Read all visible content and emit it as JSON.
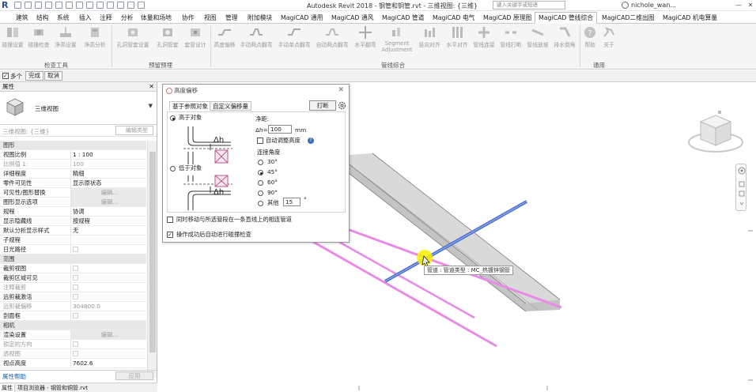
{
  "titlebar": {
    "app_title": "Autodesk Revit 2018 -   钢管和铜管.rvt - 三维视图: {三维}",
    "search_placeholder": "键入关键字或短语",
    "user": "nichole_wan...",
    "minimize": "—",
    "close": "✕"
  },
  "menu": {
    "tabs": [
      "建筑",
      "结构",
      "系统",
      "插入",
      "注释",
      "分析",
      "体量和场地",
      "协作",
      "视图",
      "管理",
      "附加模块",
      "MagiCAD 通用",
      "MagiCAD 通风",
      "MagiCAD 管道",
      "MagiCAD 电气",
      "MagiCAD 原理图",
      "MagiCAD 管线综合",
      "MagiCAD二维出图",
      "MagiCAD 机电算量"
    ],
    "active": "MagiCAD 管线综合"
  },
  "ribbon": {
    "buttons": [
      "碰撞设置",
      "碰撞检查",
      "净高设置",
      "净高分析",
      "孔洞管套设置",
      "孔洞管套",
      "套管设计",
      "高度偏移",
      "手动两点翻弯",
      "手动单点翻弯",
      "自动两点翻弯",
      "水平翻弯",
      "Segment Adjustment",
      "竖向对齐",
      "水平对齐",
      "管线连接",
      "管线打断",
      "管线放坡",
      "排水倒角",
      "帮助",
      "关于"
    ],
    "panels": [
      "检查工具",
      "预留预埋",
      "管线综合",
      "通用"
    ]
  },
  "optionbar": {
    "multi_label": "多个",
    "multi_checked": true,
    "finish_button": "完成",
    "cancel_button": "取消"
  },
  "properties": {
    "header": "属性",
    "close": "✕",
    "type_name": "三维视图",
    "view_selector": "三维视图: {三维}",
    "edit_type_button": "编辑类型",
    "rows": [
      {
        "type": "section",
        "k": "图形"
      },
      {
        "k": "视图比例",
        "v": "1 : 100"
      },
      {
        "k": "比例值 1:",
        "v": "100",
        "dim": true
      },
      {
        "k": "详细程度",
        "v": "精细"
      },
      {
        "k": "零件可见性",
        "v": "显示原状态"
      },
      {
        "k": "可见性/图形替换",
        "v": "编辑...",
        "btn": true
      },
      {
        "k": "图形显示选项",
        "v": "编辑...",
        "btn": true
      },
      {
        "k": "规程",
        "v": "协调"
      },
      {
        "k": "显示隐藏线",
        "v": "按规程"
      },
      {
        "k": "默认分析显示样式",
        "v": "无"
      },
      {
        "k": "子规程",
        "v": ""
      },
      {
        "k": "日光路径",
        "v": "",
        "check": true
      },
      {
        "type": "section",
        "k": "范围"
      },
      {
        "k": "裁剪视图",
        "v": "",
        "check": true
      },
      {
        "k": "裁剪区域可见",
        "v": "",
        "check": true
      },
      {
        "k": "注释裁剪",
        "v": "",
        "check": true,
        "dim": true
      },
      {
        "k": "远剪裁激活",
        "v": "",
        "check": true
      },
      {
        "k": "远剪裁偏移",
        "v": "304800.0",
        "dim": true
      },
      {
        "k": "剖面框",
        "v": "",
        "check": true
      },
      {
        "type": "section",
        "k": "相机"
      },
      {
        "k": "渲染设置",
        "v": "编辑...",
        "btn": true
      },
      {
        "k": "锁定的方向",
        "v": "",
        "check": true,
        "dim": true
      },
      {
        "k": "透视图",
        "v": "",
        "check": true,
        "dim": true
      },
      {
        "k": "视点高度",
        "v": "7602.6"
      }
    ],
    "help_link": "属性帮助",
    "apply_button": "应用",
    "bottom_tabs": [
      "属性",
      "项目浏览器 - 钢管和铜管.rvt"
    ]
  },
  "dialog": {
    "title": "高度偏移",
    "close": "✕",
    "tabs": [
      "基于参照对象",
      "自定义偏移量"
    ],
    "active_tab": "基于参照对象",
    "break_button": "打断",
    "above_label": "高于对象",
    "below_label": "低于对象",
    "delta_h_label": "Δh",
    "clearance_label": "净距:",
    "dh_prefix": "Δh=",
    "dh_value": "100",
    "dh_unit": "mm",
    "auto_height_label": "自动调整高度",
    "angle_label": "连接角度",
    "angles": [
      "30°",
      "45°",
      "60°",
      "90°"
    ],
    "selected_angle": "45°",
    "other_label": "其他",
    "other_value": "15",
    "other_unit": "°",
    "move_same_line_label": "同时移动与所选管段在一条直线上的相连管道",
    "auto_collision_label": "操作成功后自动进行碰撞检查",
    "auto_collision_checked": true
  },
  "viewport": {
    "tooltip": "管道 : 管道类型 : MC_热镀锌钢管",
    "colors": {
      "beam_top": "#d9d9d9",
      "beam_side": "#c4c4c4",
      "pink_pipe": "#e88ae6",
      "blue_pipe": "#4a6fd0",
      "cursor_highlight": "#f7f000"
    }
  },
  "icons": [
    "revit-logo",
    "open-icon",
    "save-icon",
    "undo-icon",
    "redo-icon",
    "search-icon",
    "user-icon",
    "cube-view-icon",
    "gear-icon",
    "help-icon",
    "viewcube-icon",
    "steering-wheel-icon",
    "zoom-icon",
    "pan-icon"
  ]
}
